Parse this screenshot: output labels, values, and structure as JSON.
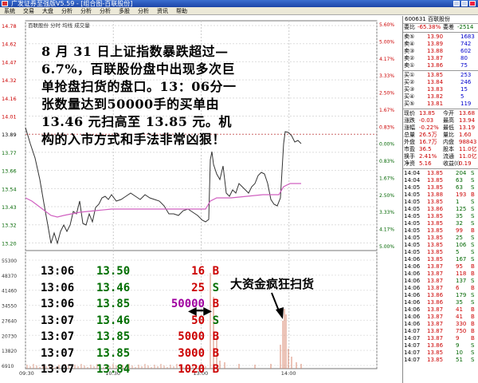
{
  "window": {
    "title": "广发证券至强版V5.59 - [组合图-百联股份]"
  },
  "menu": [
    "系统",
    "交易",
    "大盘",
    "分析",
    "分析",
    "分析",
    "多股",
    "分析",
    "资讯",
    "帮助"
  ],
  "chart": {
    "stock_label": "百联股份 分时 均线 成交量",
    "y_left": [
      "14.78",
      "14.62",
      "14.47",
      "14.32",
      "14.16",
      "14.01",
      "13.89",
      "13.77",
      "13.66",
      "13.54",
      "13.43",
      "13.32",
      "13.20"
    ],
    "y_right": [
      "5.60%",
      "5.00%",
      "4.17%",
      "3.33%",
      "2.50%",
      "1.67%",
      "0.83%",
      "0.00%",
      "0.83%",
      "1.67%",
      "2.50%",
      "3.33%",
      "4.17%",
      "5.00%"
    ],
    "vol_left": [
      "55300",
      "48370",
      "41460",
      "34550",
      "27640",
      "20730",
      "13820",
      "6910"
    ],
    "x_labels": [
      "09:30",
      "10:30",
      "13:00",
      "14:00"
    ]
  },
  "annotation": "8 月 31 日上证指数暴跌超过—6.7%，百联股份盘中出现多次巨单抢盘扫货的盘口。13：06分一张数量达到50000手的买单由 13.46 元扫高至 13.85 元。机构的入市方式和手法非常凶狠！",
  "trades": [
    {
      "t": "13:06",
      "p": "13.50",
      "v": "16",
      "bs": "B",
      "vc": "#cc0000",
      "bc": "#cc0000"
    },
    {
      "t": "13:06",
      "p": "13.46",
      "v": "25",
      "bs": "S",
      "vc": "#cc0000",
      "bc": "#006e00"
    },
    {
      "t": "13:06",
      "p": "13.85",
      "v": "50000",
      "bs": "B",
      "vc": "#a000a0",
      "bc": "#cc0000"
    },
    {
      "t": "13:07",
      "p": "13.46",
      "v": "50",
      "bs": "S",
      "vc": "#cc0000",
      "bc": "#006e00"
    },
    {
      "t": "13:07",
      "p": "13.85",
      "v": "5000",
      "bs": "B",
      "vc": "#cc0000",
      "bc": "#cc0000"
    },
    {
      "t": "13:07",
      "p": "13.85",
      "v": "3000",
      "bs": "B",
      "vc": "#cc0000",
      "bc": "#cc0000"
    },
    {
      "t": "13:07",
      "p": "13.84",
      "v": "1020",
      "bs": "B",
      "vc": "#cc0000",
      "bc": "#cc0000"
    }
  ],
  "callout": "大资金疯狂扫货",
  "right_panel": {
    "header": "600631 百联股份",
    "ratio": {
      "label1": "委比",
      "v1": "-65.38%",
      "label2": "委差",
      "v2": "-2514"
    },
    "book": [
      {
        "l": "卖⑤",
        "p": "13.90",
        "v": "1683"
      },
      {
        "l": "卖④",
        "p": "13.89",
        "v": "742"
      },
      {
        "l": "卖③",
        "p": "13.88",
        "v": "602"
      },
      {
        "l": "卖②",
        "p": "13.87",
        "v": "80"
      },
      {
        "l": "卖①",
        "p": "13.86",
        "v": "75"
      },
      {
        "l": "买①",
        "p": "13.85",
        "v": "253"
      },
      {
        "l": "买②",
        "p": "13.84",
        "v": "246"
      },
      {
        "l": "买③",
        "p": "13.83",
        "v": "15"
      },
      {
        "l": "买④",
        "p": "13.82",
        "v": "5"
      },
      {
        "l": "买⑤",
        "p": "13.81",
        "v": "119"
      }
    ],
    "stats": [
      {
        "a": "现价",
        "b": "13.85",
        "c": "今开",
        "d": "13.68"
      },
      {
        "a": "涨跌",
        "b": "-0.03",
        "c": "最高",
        "d": "13.94"
      },
      {
        "a": "涨幅",
        "b": "-0.22%",
        "c": "最低",
        "d": "13.19"
      },
      {
        "a": "总量",
        "b": "26.5万",
        "c": "量比",
        "d": "1.60"
      },
      {
        "a": "外盘",
        "b": "16.7万",
        "c": "内盘",
        "d": "98843"
      },
      {
        "a": "市盈",
        "b": "36.5",
        "c": "股本",
        "d": "11.0亿"
      },
      {
        "a": "换手",
        "b": "2.41%",
        "c": "流通",
        "d": "11.0亿"
      },
      {
        "a": "净资",
        "b": "5.16",
        "c": "收益(I)",
        "d": "0.19"
      }
    ],
    "ticks": [
      {
        "t": "14:04",
        "p": "13.85",
        "v": "204",
        "s": "S"
      },
      {
        "t": "14:04",
        "p": "13.85",
        "v": "63",
        "s": "S"
      },
      {
        "t": "14:05",
        "p": "13.85",
        "v": "63",
        "s": "S"
      },
      {
        "t": "14:05",
        "p": "13.88",
        "v": "193",
        "s": "B"
      },
      {
        "t": "14:05",
        "p": "13.85",
        "v": "1",
        "s": "S"
      },
      {
        "t": "14:05",
        "p": "13.86",
        "v": "125",
        "s": "S"
      },
      {
        "t": "14:05",
        "p": "13.85",
        "v": "35",
        "s": "S"
      },
      {
        "t": "14:05",
        "p": "13.85",
        "v": "32",
        "s": "S"
      },
      {
        "t": "14:05",
        "p": "13.85",
        "v": "99",
        "s": "B"
      },
      {
        "t": "14:05",
        "p": "13.85",
        "v": "25",
        "s": "S"
      },
      {
        "t": "14:05",
        "p": "13.85",
        "v": "106",
        "s": "S"
      },
      {
        "t": "14:05",
        "p": "13.85",
        "v": "5",
        "s": "S"
      },
      {
        "t": "14:06",
        "p": "13.85",
        "v": "167",
        "s": "S"
      },
      {
        "t": "14:06",
        "p": "13.87",
        "v": "95",
        "s": "B"
      },
      {
        "t": "14:06",
        "p": "13.87",
        "v": "118",
        "s": "B"
      },
      {
        "t": "14:06",
        "p": "13.87",
        "v": "137",
        "s": "S"
      },
      {
        "t": "14:06",
        "p": "13.87",
        "v": "6",
        "s": "B"
      },
      {
        "t": "14:06",
        "p": "13.86",
        "v": "179",
        "s": "S"
      },
      {
        "t": "14:06",
        "p": "13.86",
        "v": "35",
        "s": "S"
      },
      {
        "t": "14:06",
        "p": "13.87",
        "v": "41",
        "s": "B"
      },
      {
        "t": "14:06",
        "p": "13.87",
        "v": "41",
        "s": "B"
      },
      {
        "t": "14:06",
        "p": "13.87",
        "v": "330",
        "s": "B"
      },
      {
        "t": "14:07",
        "p": "13.87",
        "v": "750",
        "s": "B"
      },
      {
        "t": "14:07",
        "p": "13.87",
        "v": "9",
        "s": "B"
      },
      {
        "t": "14:07",
        "p": "13.86",
        "v": "9",
        "s": "S"
      },
      {
        "t": "14:07",
        "p": "13.85",
        "v": "10",
        "s": "S"
      },
      {
        "t": "14:07",
        "p": "13.85",
        "v": "51",
        "s": "S"
      }
    ]
  }
}
